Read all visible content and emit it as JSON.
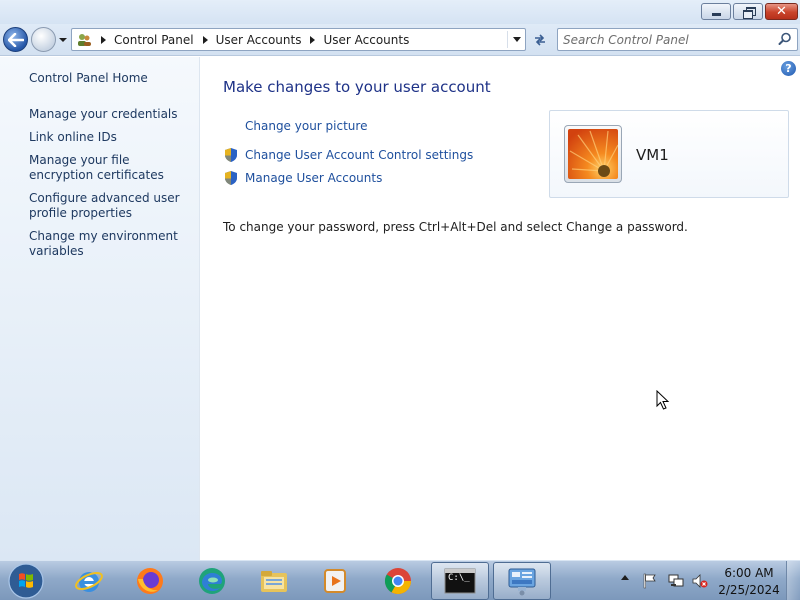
{
  "window": {
    "minimize_icon": "minimize-icon",
    "maximize_icon": "restore-icon",
    "close_icon": "close-icon"
  },
  "navbar": {
    "breadcrumbs": [
      "Control Panel",
      "User Accounts",
      "User Accounts"
    ],
    "search_placeholder": "Search Control Panel"
  },
  "sidebar": {
    "items": [
      {
        "label": "Control Panel Home"
      },
      {
        "label": "Manage your credentials"
      },
      {
        "label": "Link online IDs"
      },
      {
        "label": "Manage your file encryption certificates"
      },
      {
        "label": "Configure advanced user profile properties"
      },
      {
        "label": "Change my environment variables"
      }
    ]
  },
  "main": {
    "title": "Make changes to your user account",
    "tasks": [
      {
        "label": "Change your picture",
        "icon": "none"
      },
      {
        "label": "Change User Account Control settings",
        "icon": "shield-icon"
      },
      {
        "label": "Manage User Accounts",
        "icon": "shield-icon"
      }
    ],
    "password_note": "To change your password, press Ctrl+Alt+Del and select Change a password.",
    "help_label": "?",
    "user": {
      "name": "VM1",
      "picture": "orange-flower-picture"
    }
  },
  "taskbar": {
    "apps": [
      "windows-start-icon",
      "internet-explorer-icon",
      "firefox-icon",
      "edge-icon",
      "file-explorer-icon",
      "media-player-icon",
      "chrome-icon",
      "command-prompt-icon",
      "control-panel-icon"
    ],
    "cmd_glyph": "C:\\_",
    "clock": {
      "time": "6:00 AM",
      "date": "2/25/2024"
    }
  },
  "colors": {
    "link": "#1e4f9d",
    "title": "#1e3287",
    "sidebar_link": "#1e3960"
  }
}
